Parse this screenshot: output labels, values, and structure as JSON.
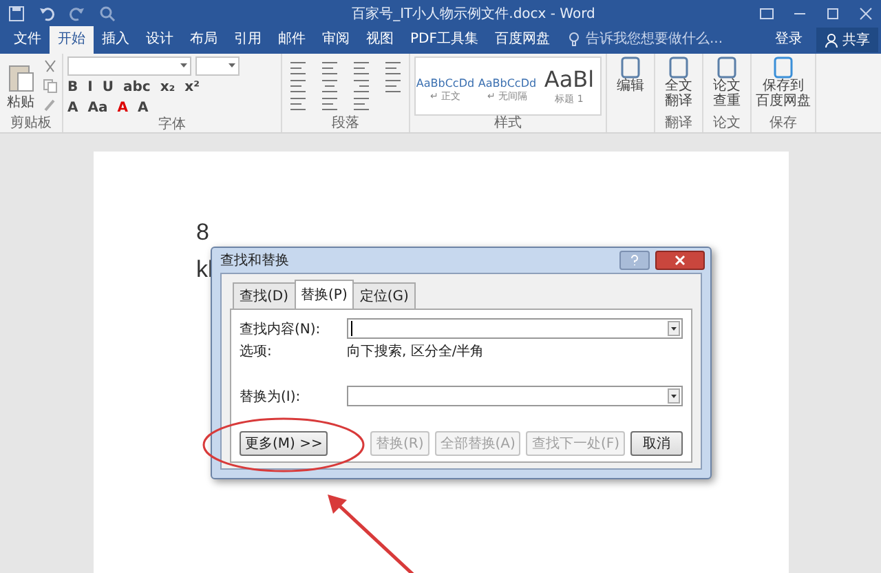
{
  "window": {
    "title": "百家号_IT小人物示例文件.docx - Word"
  },
  "ribbon_tabs": [
    {
      "label": "文件",
      "selected": false
    },
    {
      "label": "开始",
      "selected": true
    },
    {
      "label": "插入",
      "selected": false
    },
    {
      "label": "设计",
      "selected": false
    },
    {
      "label": "布局",
      "selected": false
    },
    {
      "label": "引用",
      "selected": false
    },
    {
      "label": "邮件",
      "selected": false
    },
    {
      "label": "审阅",
      "selected": false
    },
    {
      "label": "视图",
      "selected": false
    },
    {
      "label": "PDF工具集",
      "selected": false
    },
    {
      "label": "百度网盘",
      "selected": false
    }
  ],
  "tell_me": {
    "placeholder": "告诉我您想要做什么..."
  },
  "sign_in": "登录",
  "share": "共享",
  "clipboard": {
    "paste": "粘贴",
    "group": "剪贴板"
  },
  "font": {
    "group": "字体",
    "format_buttons": [
      "B",
      "I",
      "U",
      "abc",
      "x₂",
      "x²"
    ],
    "size_buttons": [
      "A",
      "Aa",
      "A",
      "A"
    ]
  },
  "paragraph": {
    "group": "段落"
  },
  "styles": {
    "group": "样式",
    "items": [
      {
        "sample": "AaBbCcDd",
        "name": "↵ 正文",
        "kind": "small"
      },
      {
        "sample": "AaBbCcDd",
        "name": "↵ 无间隔",
        "kind": "small"
      },
      {
        "sample": "AaBl",
        "name": "标题 1",
        "kind": "large"
      }
    ]
  },
  "tools": [
    {
      "lines": [
        "编辑"
      ]
    },
    {
      "lines": [
        "全文",
        "翻译"
      ],
      "group": "翻译"
    },
    {
      "lines": [
        "论文",
        "查重"
      ],
      "group": "论文"
    },
    {
      "lines": [
        "保存到",
        "百度网盘"
      ],
      "group": "保存"
    }
  ],
  "document": {
    "lines": [
      "8",
      "kl"
    ]
  },
  "dialog": {
    "title": "查找和替换",
    "tabs": [
      {
        "label": "查找(D)",
        "selected": false
      },
      {
        "label": "替换(P)",
        "selected": true
      },
      {
        "label": "定位(G)",
        "selected": false
      }
    ],
    "find_label": "查找内容(N):",
    "options_label": "选项:",
    "options_value": "向下搜索, 区分全/半角",
    "replace_label": "替换为(I):",
    "buttons": [
      {
        "label": "更多(M) >>",
        "disabled": false
      },
      {
        "label": "替换(R)",
        "disabled": true
      },
      {
        "label": "全部替换(A)",
        "disabled": true
      },
      {
        "label": "查找下一处(F)",
        "disabled": true
      },
      {
        "label": "取消",
        "disabled": false
      }
    ]
  }
}
